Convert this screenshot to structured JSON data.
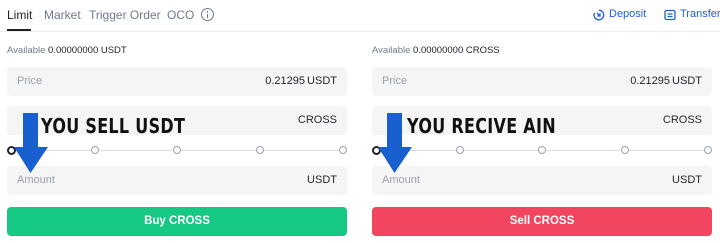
{
  "tabs": [
    "Limit",
    "Market",
    "Trigger Order",
    "OCO"
  ],
  "header": {
    "deposit": "Deposit",
    "transfer": "Transfer"
  },
  "buy_panel": {
    "available_label": "Available",
    "available_value": "0.00000000 USDT",
    "price_label": "Price",
    "price_value": "0.21295",
    "price_unit": "USDT",
    "total_unit": "CROSS",
    "amount_label": "Amount",
    "amount_unit": "USDT",
    "button": "Buy CROSS"
  },
  "sell_panel": {
    "available_label": "Available",
    "available_value": "0.00000000 CROSS",
    "price_label": "Price",
    "price_value": "0.21295",
    "price_unit": "USDT",
    "total_unit": "CROSS",
    "amount_label": "Amount",
    "amount_unit": "USDT",
    "button": "Sell CROSS"
  },
  "annotations": {
    "left": "YOU SELL USDT",
    "right": "YOU RECIVE AIN"
  },
  "colors": {
    "buy": "#15c984",
    "sell": "#f24560",
    "link": "#1f5fd8",
    "arrow": "#1a5fd0"
  },
  "icons": {
    "info": "info-icon",
    "deposit": "deposit-icon",
    "transfer": "transfer-icon",
    "annotation": "down-arrow-icon"
  }
}
